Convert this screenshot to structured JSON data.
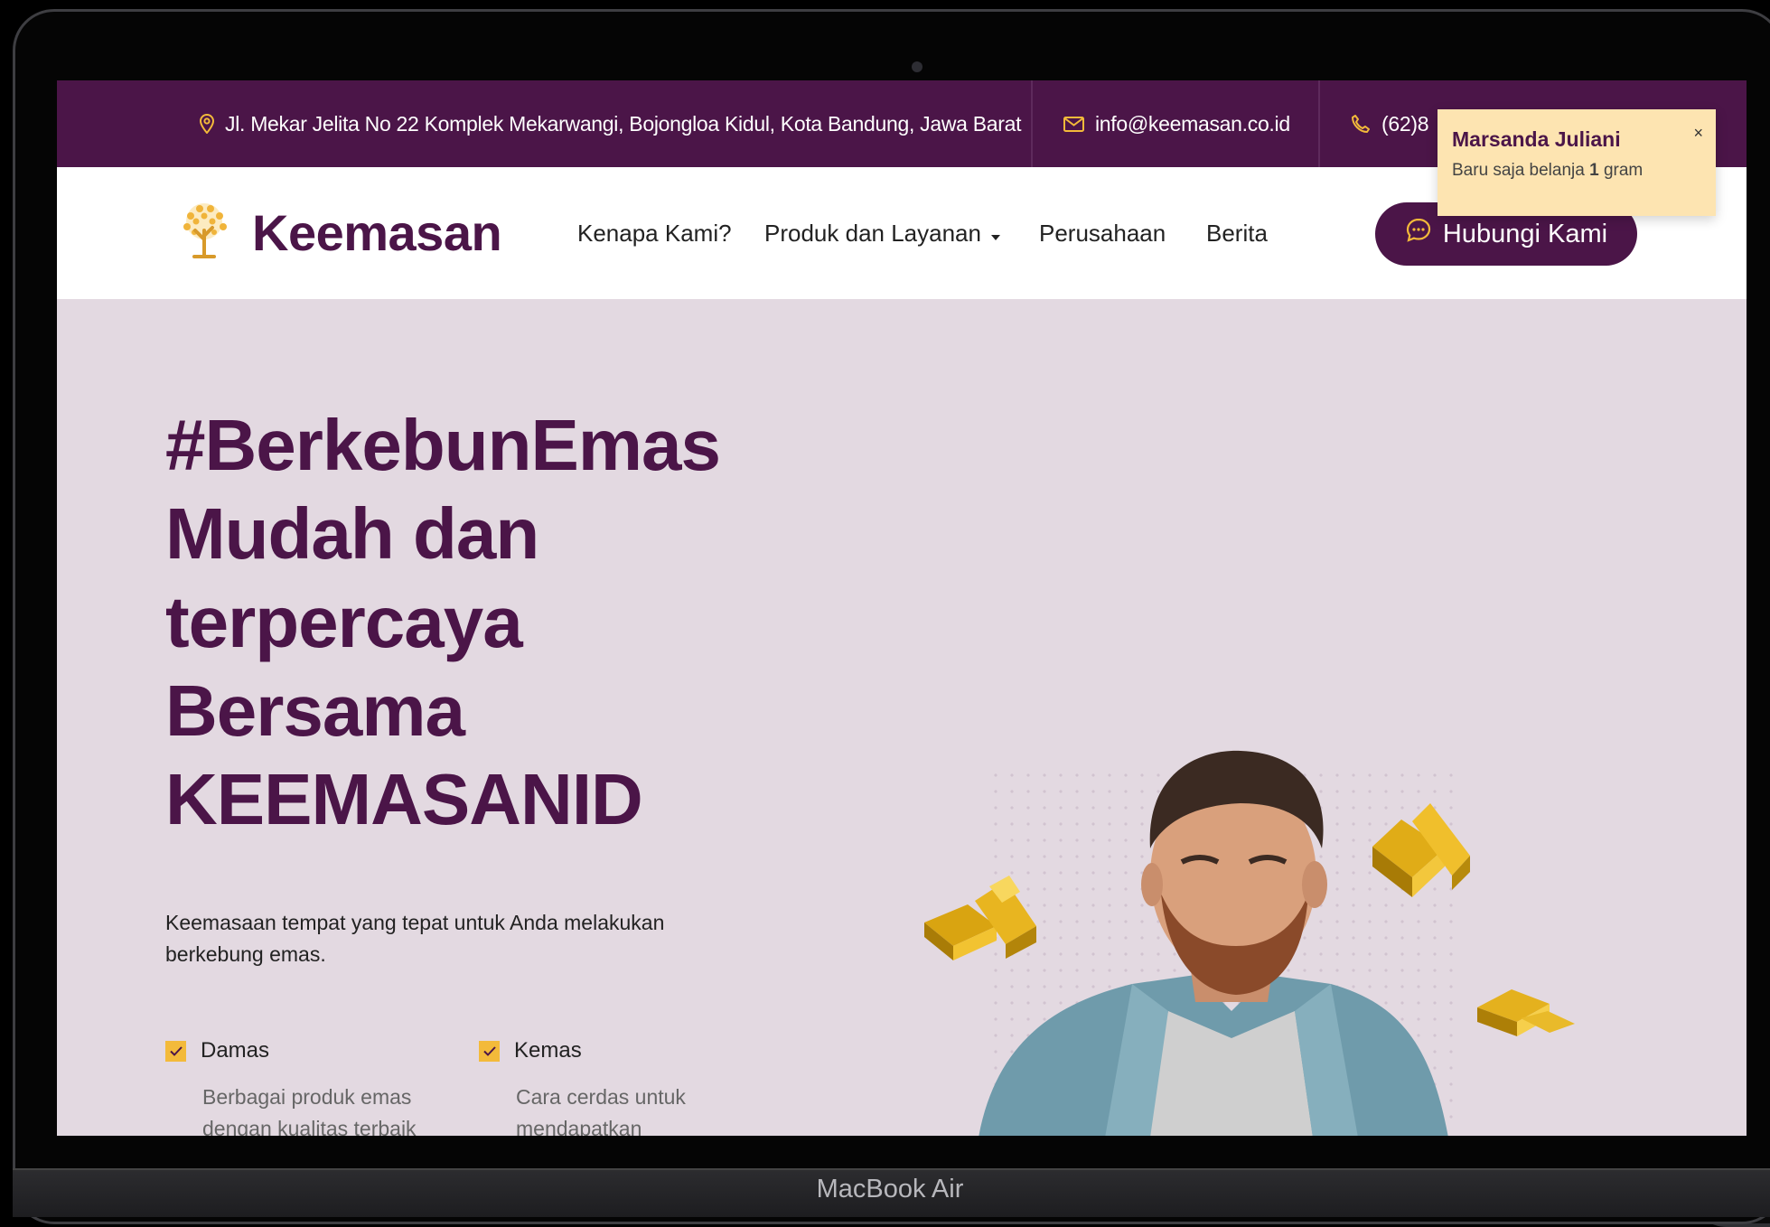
{
  "topbar": {
    "address": "Jl. Mekar Jelita No 22 Komplek Mekarwangi, Bojongloa Kidul, Kota Bandung, Jawa Barat",
    "email": "info@keemasan.co.id",
    "phone": "(62)8"
  },
  "nav": {
    "brand": "Keemasan",
    "links": [
      "Kenapa Kami?",
      "Produk dan Layanan",
      "Perusahaan",
      "Berita"
    ],
    "cta": "Hubungi Kami"
  },
  "hero": {
    "title_lines": [
      "#BerkebunEmas",
      "Mudah dan",
      "terpercaya",
      "Bersama",
      "KEEMASANID"
    ],
    "description": "Keemasaan tempat yang tepat untuk Anda melakukan berkebung emas.",
    "features": [
      {
        "title": "Damas",
        "desc": "Berbagai produk emas dengan kualitas terbaik"
      },
      {
        "title": "Kemas",
        "desc": "Cara cerdas untuk mendapatkan"
      }
    ]
  },
  "toast": {
    "name": "Marsanda Juliani",
    "message_prefix": "Baru saja belanja",
    "amount": "1",
    "unit": "gram",
    "close": "×"
  },
  "device_label": "MacBook Air",
  "colors": {
    "brand": "#4b1548",
    "hero_bg": "#e3d9e1",
    "accent_gold": "#f3ba3a",
    "toast_bg": "#fde4b1"
  },
  "icons": [
    "location-pin-icon",
    "mail-icon",
    "phone-icon",
    "tree-logo-icon",
    "chat-icon",
    "caret-down-icon",
    "check-icon",
    "close-icon"
  ]
}
